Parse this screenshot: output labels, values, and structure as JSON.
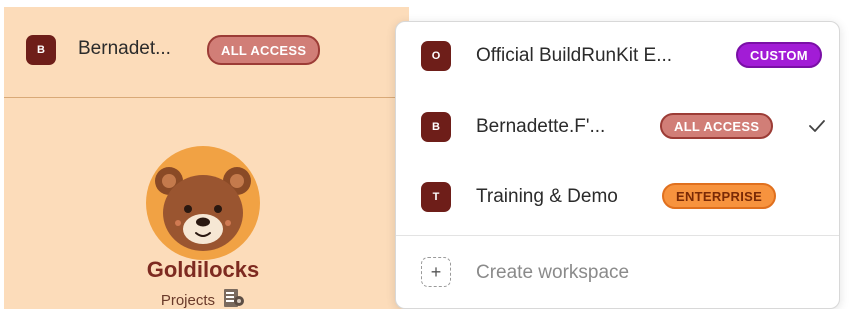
{
  "sidebar": {
    "workspace": {
      "avatar_letter": "B",
      "name": "Bernadet...",
      "badge": "ALL ACCESS"
    },
    "logo": {
      "name": "Goldilocks",
      "subtitle": "Projects",
      "icon": "bear-icon"
    }
  },
  "menu": {
    "items": [
      {
        "avatar_letter": "O",
        "label": "Official BuildRunKit E...",
        "badge": "CUSTOM",
        "selected": false
      },
      {
        "avatar_letter": "B",
        "label": "Bernadette.F'...",
        "badge": "ALL ACCESS",
        "selected": true
      },
      {
        "avatar_letter": "T",
        "label": "Training & Demo",
        "badge": "ENTERPRISE",
        "selected": false
      }
    ],
    "create_label": "Create workspace",
    "create_icon": "+"
  },
  "colors": {
    "sidebar_bg": "#fcdcba",
    "avatar_bg": "#6e1e19",
    "badge_all_access": "#d17e77",
    "badge_custom": "#a21cd6",
    "badge_enterprise": "#f7933e",
    "logo_text": "#7d2a20"
  }
}
